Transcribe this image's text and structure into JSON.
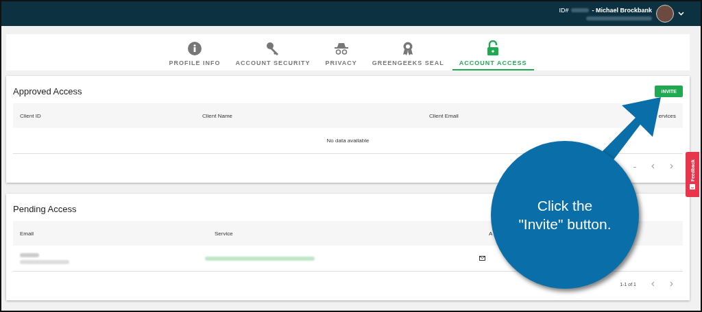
{
  "header": {
    "id_label": "ID#",
    "user_name": "- Michael Brockbank"
  },
  "tabs": [
    {
      "label": "PROFILE INFO",
      "selected": false
    },
    {
      "label": "ACCOUNT SECURITY",
      "selected": false
    },
    {
      "label": "PRIVACY",
      "selected": false
    },
    {
      "label": "GREENGEEKS SEAL",
      "selected": false
    },
    {
      "label": "ACCOUNT ACCESS",
      "selected": true
    }
  ],
  "approved": {
    "title": "Approved Access",
    "invite_button": "INVITE",
    "columns": [
      "Client ID",
      "Client Name",
      "Client Email",
      "ervices"
    ],
    "empty_text": "No data available",
    "pagination": "–"
  },
  "pending": {
    "title": "Pending Access",
    "columns": [
      "Email",
      "Service",
      "A"
    ],
    "pagination": "1-1 of 1"
  },
  "feedback": "Feedback",
  "callout": {
    "text": "Click the \"Invite\" button."
  }
}
